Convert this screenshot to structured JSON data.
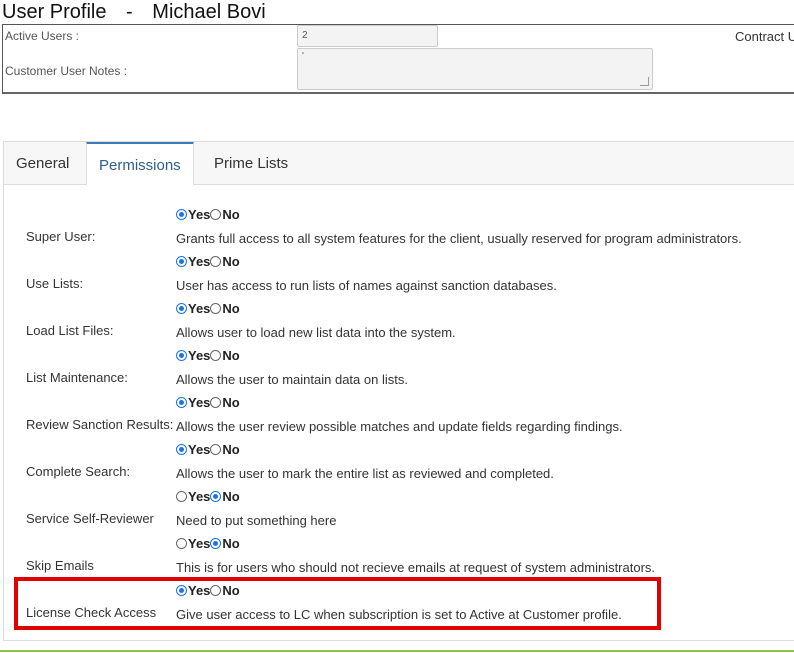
{
  "header": {
    "title": "User Profile",
    "separator": "-",
    "user_name": "Michael Bovi"
  },
  "profile": {
    "active_users_label": "Active Users :",
    "active_users_value": "2",
    "contract_label": "Contract U",
    "notes_label": "Customer User Notes :",
    "notes_value": "'"
  },
  "tabs": [
    {
      "label": "General",
      "active": false
    },
    {
      "label": "Permissions",
      "active": true
    },
    {
      "label": "Prime Lists",
      "active": false
    }
  ],
  "radio_labels": {
    "yes": "Yes",
    "no": "No"
  },
  "permissions": [
    {
      "label": "Super User:",
      "value": "Yes",
      "description": "Grants full access to all system features for the client, usually reserved for program administrators."
    },
    {
      "label": "Use Lists:",
      "value": "Yes",
      "description": "User has access to run lists of names against sanction databases."
    },
    {
      "label": "Load List Files:",
      "value": "Yes",
      "description": "Allows user to load new list data into the system."
    },
    {
      "label": "List Maintenance:",
      "value": "Yes",
      "description": "Allows the user to maintain data on lists."
    },
    {
      "label": "Review Sanction Results:",
      "value": "Yes",
      "description": "Allows the user review possible matches and update fields regarding findings."
    },
    {
      "label": "Complete Search:",
      "value": "Yes",
      "description": "Allows the user to mark the entire list as reviewed and completed."
    },
    {
      "label": "Service Self-Reviewer",
      "value": "No",
      "description": "Need to put something here"
    },
    {
      "label": "Skip Emails",
      "value": "No",
      "description": "This is for users who should not recieve emails at request of system administrators."
    },
    {
      "label": "License Check Access",
      "value": "Yes",
      "description": "Give user access to LC when subscription is set to Active at Customer profile."
    }
  ],
  "colors": {
    "highlight": "#e00000",
    "radio_checked": "#1a73e8",
    "active_tab": "#2c5f8a",
    "footer_line": "#8dc63f"
  }
}
